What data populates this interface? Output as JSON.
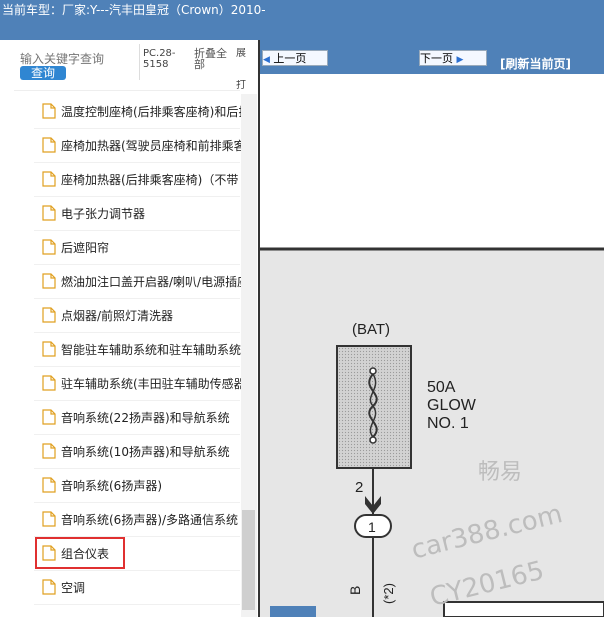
{
  "topbar": {
    "label": "当前车型：",
    "vehicle": "厂家:Y---汽丰田皇冠（Crown）2010-"
  },
  "search": {
    "placeholder": "输入关键字查询",
    "button_label": "查询"
  },
  "header": {
    "col1": "PC.28-5158",
    "col2": "折叠全部",
    "col3": "展",
    "col4": "打"
  },
  "tree": {
    "items": [
      "温度控制座椅(后排乘客座椅)和后排",
      "座椅加热器(驾驶员座椅和前排乘客",
      "座椅加热器(后排乘客座椅)（不带",
      "电子张力调节器",
      "后遮阳帘",
      "燃油加注口盖开启器/喇叭/电源插座",
      "点烟器/前照灯清洗器",
      "智能驻车辅助系统和驻车辅助系统",
      "驻车辅助系统(丰田驻车辅助传感器",
      "音响系统(22扬声器)和导航系统",
      "音响系统(10扬声器)和导航系统",
      "音响系统(6扬声器)",
      "音响系统(6扬声器)/多路通信系统",
      "组合仪表",
      "空调"
    ],
    "selected": "空调"
  },
  "toolbar": {
    "prev_label": "上一页",
    "next_label": "下一页",
    "refresh_label": "[刷新当前页]"
  },
  "diagram": {
    "source_label": "(BAT)",
    "fuse_rating": "50A",
    "fuse_name_1": "GLOW",
    "fuse_name_2": "NO. 1",
    "pin_number": "2",
    "connector": "1",
    "wire_color": "B",
    "note": "(*2)",
    "watermark_1": "畅易",
    "watermark_2": "car388.com",
    "watermark_3": "CY20165"
  },
  "colors": {
    "topbar": "#4f81b8",
    "search_button": "#2f86d2",
    "highlight": "#e03030",
    "doc_bg": "#e6e6e6"
  }
}
